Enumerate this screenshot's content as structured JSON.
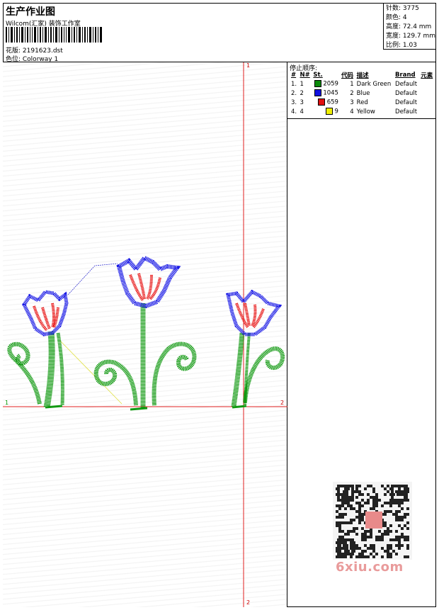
{
  "header": {
    "title": "生产作业图",
    "company": "Wilcom(汇家) 装饰工作室",
    "design_line": "花版: 2191623.dst",
    "colorway_line": "色位: Colorway 1"
  },
  "stats": {
    "stitches": "针数: 3775",
    "colors": "颜色: 4",
    "height": "高度: 72.4 mm",
    "width": "宽度: 129.7 mm",
    "ratio": "比例: 1.03"
  },
  "stop_sequence": {
    "title": "停止顺序:",
    "columns": [
      "#",
      "N#",
      "St.",
      "代码",
      "描述",
      "Brand",
      "元素"
    ],
    "rows": [
      {
        "idx": "1.",
        "n": "1",
        "st": "2059",
        "code": "1",
        "desc": "Dark Green",
        "brand": "Default",
        "swatch": "#0a8a0a"
      },
      {
        "idx": "2.",
        "n": "2",
        "st": "1045",
        "code": "2",
        "desc": "Blue",
        "brand": "Default",
        "swatch": "#1010e0"
      },
      {
        "idx": "3.",
        "n": "3",
        "st": "659",
        "code": "3",
        "desc": "Red",
        "brand": "Default",
        "swatch": "#e01010"
      },
      {
        "idx": "4.",
        "n": "4",
        "st": "9",
        "code": "4",
        "desc": "Yellow",
        "brand": "Default",
        "swatch": "#f0f000"
      }
    ]
  },
  "axes": {
    "top_marker": "1",
    "bottom_marker": "2",
    "left_marker": "1",
    "right_marker": "2"
  },
  "watermark": "6xiu.com",
  "colors": {
    "green": "#119911",
    "blue": "#1a1ae6",
    "red": "#e81414",
    "axis": "#e02020"
  }
}
